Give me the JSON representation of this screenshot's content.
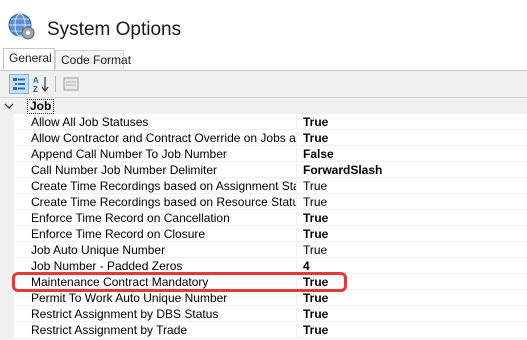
{
  "window": {
    "title": "System Options"
  },
  "tabs": [
    {
      "label": "General",
      "active": true
    },
    {
      "label": "Code Format",
      "active": false
    }
  ],
  "toolbar": {
    "categorized_icon": "categorized-view-icon",
    "alphabetical_icon": "alphabetical-sort-icon",
    "property_pages_icon": "property-pages-icon"
  },
  "grid": {
    "category": {
      "label": "Job",
      "expanded": true
    },
    "properties": [
      {
        "name": "Allow All Job Statuses",
        "value": "True",
        "bold": true
      },
      {
        "name": "Allow Contractor and Contract Override on Jobs and Ord",
        "value": "True",
        "bold": true
      },
      {
        "name": "Append Call Number To Job Number",
        "value": "False",
        "bold": true
      },
      {
        "name": "Call Number Job Number Delimiter",
        "value": "ForwardSlash",
        "bold": true
      },
      {
        "name": "Create Time Recordings based on Assignment Status",
        "value": "True",
        "bold": false
      },
      {
        "name": "Create Time Recordings based on Resource Status",
        "value": "True",
        "bold": false
      },
      {
        "name": "Enforce Time Record on Cancellation",
        "value": "True",
        "bold": true
      },
      {
        "name": "Enforce Time Record on Closure",
        "value": "True",
        "bold": true
      },
      {
        "name": "Job Auto Unique Number",
        "value": "True",
        "bold": false
      },
      {
        "name": "Job Number - Padded Zeros",
        "value": "4",
        "bold": true
      },
      {
        "name": "Maintenance Contract Mandatory",
        "value": "True",
        "bold": true,
        "highlighted": true
      },
      {
        "name": "Permit To Work Auto Unique Number",
        "value": "True",
        "bold": true
      },
      {
        "name": "Restrict Assignment by DBS Status",
        "value": "True",
        "bold": true
      },
      {
        "name": "Restrict Assignment by Trade",
        "value": "True",
        "bold": true
      }
    ]
  },
  "colors": {
    "highlight": "#e23a3a",
    "gutter": "#f0f0f0",
    "selected_button": "#c9e0f7"
  }
}
